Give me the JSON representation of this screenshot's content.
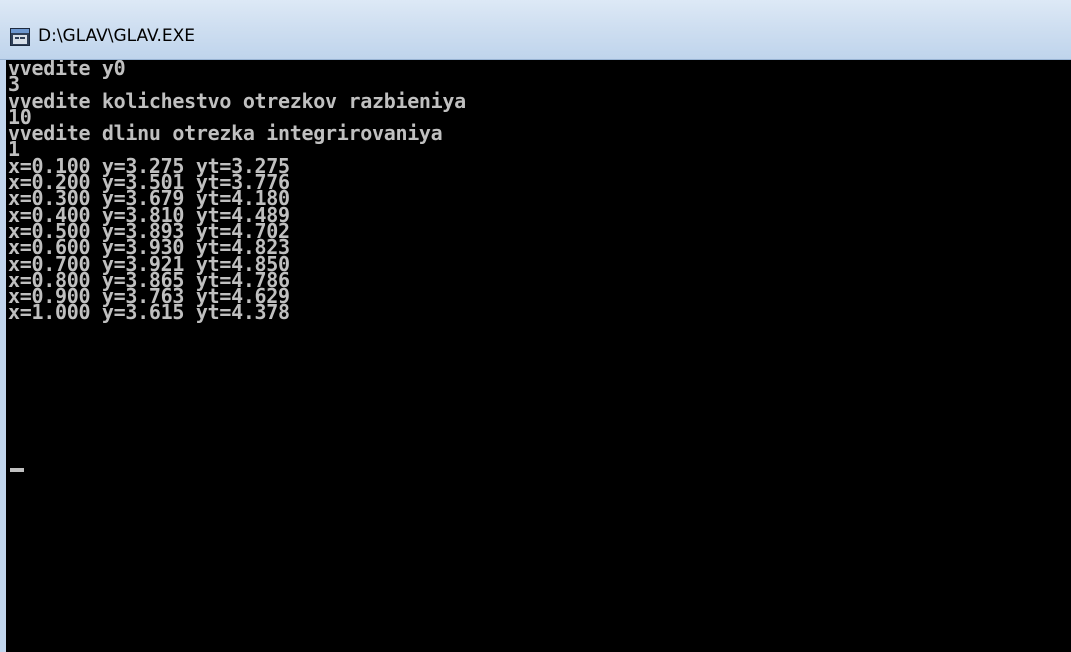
{
  "window": {
    "title": "D:\\GLAV\\GLAV.EXE",
    "icon": "console-window-icon"
  },
  "console": {
    "lines": [
      "vvedite y0",
      "3",
      "vvedite kolichestvo otrezkov razbieniya",
      "10",
      "vvedite dlinu otrezka integrirovaniya",
      "1",
      "x=0.100 y=3.275 yt=3.275",
      "x=0.200 y=3.501 yt=3.776",
      "x=0.300 y=3.679 yt=4.180",
      "x=0.400 y=3.810 yt=4.489",
      "x=0.500 y=3.893 yt=4.702",
      "x=0.600 y=3.930 yt=4.823",
      "x=0.700 y=3.921 yt=4.850",
      "x=0.800 y=3.865 yt=4.786",
      "x=0.900 y=3.763 yt=4.629",
      "x=1.000 y=3.615 yt=4.378"
    ],
    "text_color": "#c0c0c0",
    "background_color": "#000000"
  }
}
